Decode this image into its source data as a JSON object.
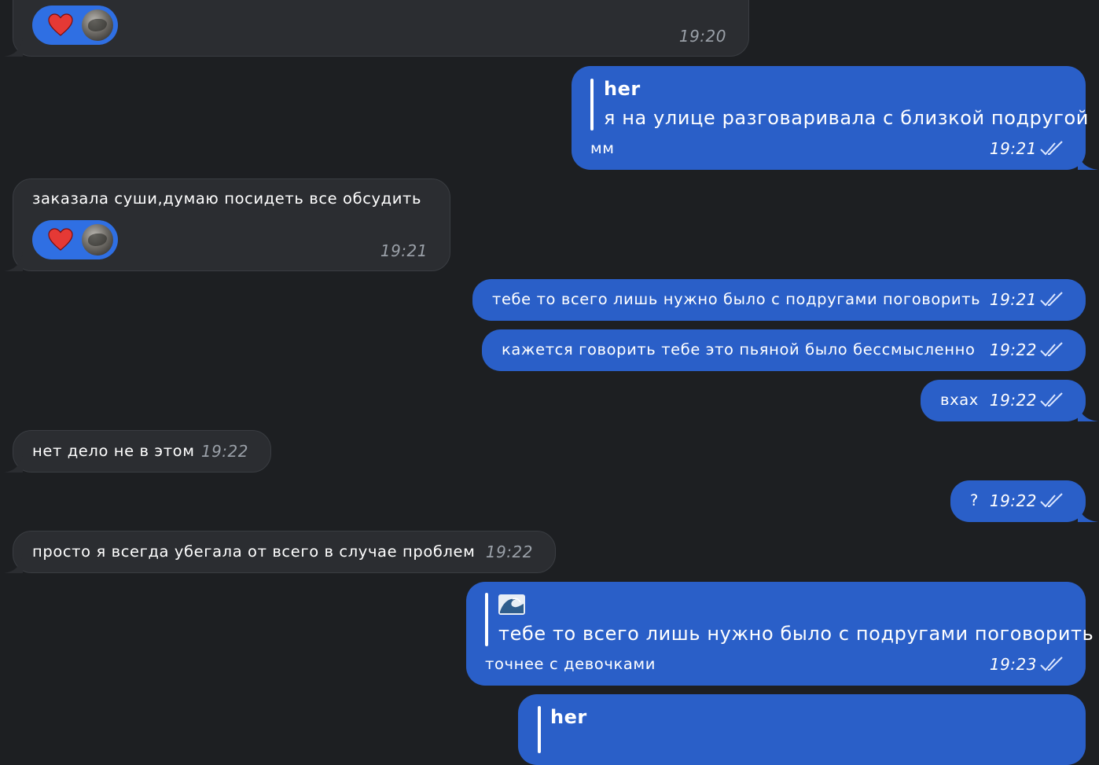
{
  "messages": [
    {
      "id": "m1",
      "side": "in",
      "time": "19:20",
      "reaction": "heart"
    },
    {
      "id": "m2",
      "side": "out",
      "reply_author": "her",
      "reply_text": "я на улице разговаривала с близкой подругой",
      "text": "мм",
      "time": "19:21"
    },
    {
      "id": "m3",
      "side": "in",
      "text": "заказала суши,думаю посидеть все обсудить",
      "time": "19:21",
      "reaction": "heart"
    },
    {
      "id": "m4",
      "side": "out",
      "text": "тебе то всего лишь нужно было с подругами поговорить",
      "time": "19:21"
    },
    {
      "id": "m5",
      "side": "out",
      "text": "кажется говорить тебе это пьяной было бессмысленно",
      "time": "19:22"
    },
    {
      "id": "m6",
      "side": "out",
      "text": "вхах",
      "time": "19:22"
    },
    {
      "id": "m7",
      "side": "in",
      "text": "нет дело не в этом",
      "time": "19:22"
    },
    {
      "id": "m8",
      "side": "out",
      "text": "?",
      "time": "19:22"
    },
    {
      "id": "m9",
      "side": "in",
      "text": "просто я всегда убегала от всего в случае проблем",
      "time": "19:22"
    },
    {
      "id": "m10",
      "side": "out",
      "reply_author_icon": "wave-emoji-icon",
      "reply_text": "тебе то всего лишь нужно было с подругами поговорить",
      "text": "точнее с девочками",
      "time": "19:23"
    },
    {
      "id": "m11",
      "side": "out",
      "reply_author": "her"
    }
  ],
  "colors": {
    "background": "#1d1f22",
    "incoming_bubble": "#2b2d31",
    "outgoing_bubble": "#2a5fc8",
    "reaction_pill": "#2f6fe3",
    "heart": "#e53935"
  }
}
